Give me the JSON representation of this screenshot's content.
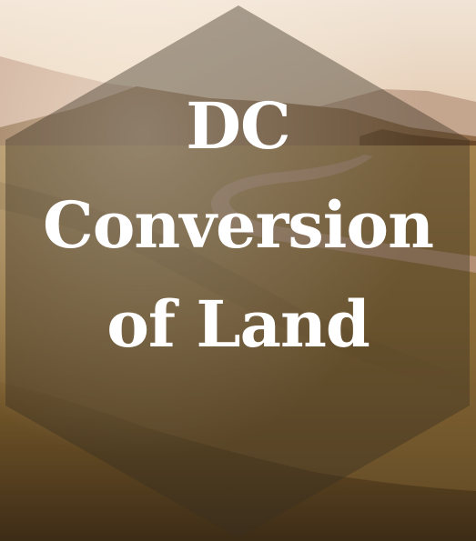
{
  "poster": {
    "title_lines": [
      "DC",
      "Conversion",
      "of Land"
    ]
  },
  "colors": {
    "sky": "#e9d8c4",
    "field": "#8a6a35",
    "road": "#b48f6e",
    "hexagon_overlay": "#3a2f22",
    "title_text": "#ffffff"
  },
  "icons": {
    "background": "landscape-photo",
    "overlay": "hexagon-shape"
  }
}
